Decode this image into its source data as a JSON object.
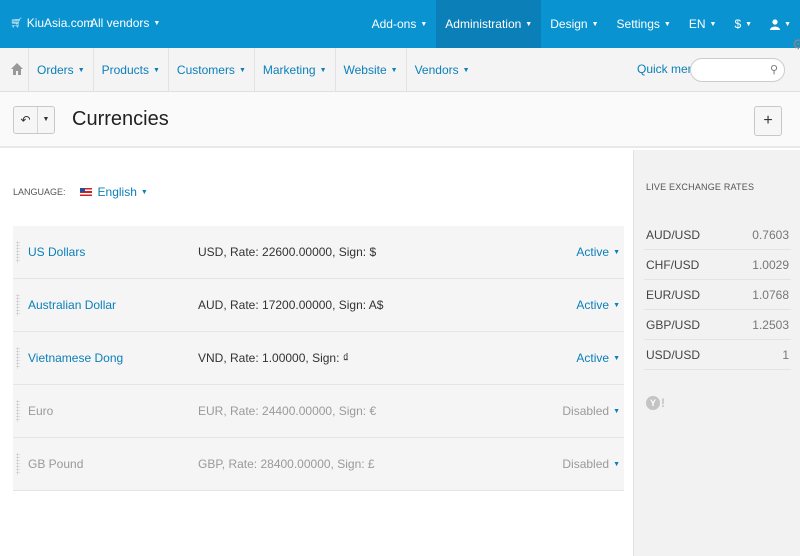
{
  "topbar": {
    "brand": "KiuAsia.com",
    "vendor_selector": "All vendors",
    "menu": [
      {
        "label": "Add-ons",
        "active": false
      },
      {
        "label": "Administration",
        "active": true
      },
      {
        "label": "Design",
        "active": false
      },
      {
        "label": "Settings",
        "active": false
      },
      {
        "label": "EN",
        "active": false
      },
      {
        "label": "$",
        "active": false
      },
      {
        "label": "",
        "active": false,
        "icon": "user-icon"
      }
    ],
    "colors": {
      "bar": "#0993d0",
      "active": "#0b7fb8"
    }
  },
  "subnav": {
    "items": [
      "Orders",
      "Products",
      "Customers",
      "Marketing",
      "Website",
      "Vendors"
    ],
    "quick_menu": "Quick menu",
    "search": {
      "placeholder": "",
      "value": ""
    }
  },
  "page": {
    "title": "Currencies"
  },
  "language": {
    "label": "LANGUAGE:",
    "value": "English"
  },
  "currencies": [
    {
      "name": "US Dollars",
      "desc": "USD, Rate: 22600.00000, Sign: $",
      "status": "Active",
      "enabled": true
    },
    {
      "name": "Australian Dollar",
      "desc": "AUD, Rate: 17200.00000, Sign: A$",
      "status": "Active",
      "enabled": true
    },
    {
      "name": "Vietnamese Dong",
      "desc": "VND, Rate: 1.00000, Sign: ₫",
      "status": "Active",
      "enabled": true
    },
    {
      "name": "Euro",
      "desc": "EUR, Rate: 24400.00000, Sign: €",
      "status": "Disabled",
      "enabled": false
    },
    {
      "name": "GB Pound",
      "desc": "GBP, Rate: 28400.00000, Sign: £",
      "status": "Disabled",
      "enabled": false
    }
  ],
  "sidebar": {
    "title": "LIVE EXCHANGE RATES",
    "rates": [
      {
        "pair": "AUD/USD",
        "value": "0.7603"
      },
      {
        "pair": "CHF/USD",
        "value": "1.0029"
      },
      {
        "pair": "EUR/USD",
        "value": "1.0768"
      },
      {
        "pair": "GBP/USD",
        "value": "1.2503"
      },
      {
        "pair": "USD/USD",
        "value": "1"
      }
    ],
    "provider_icon": "yahoo-icon"
  }
}
